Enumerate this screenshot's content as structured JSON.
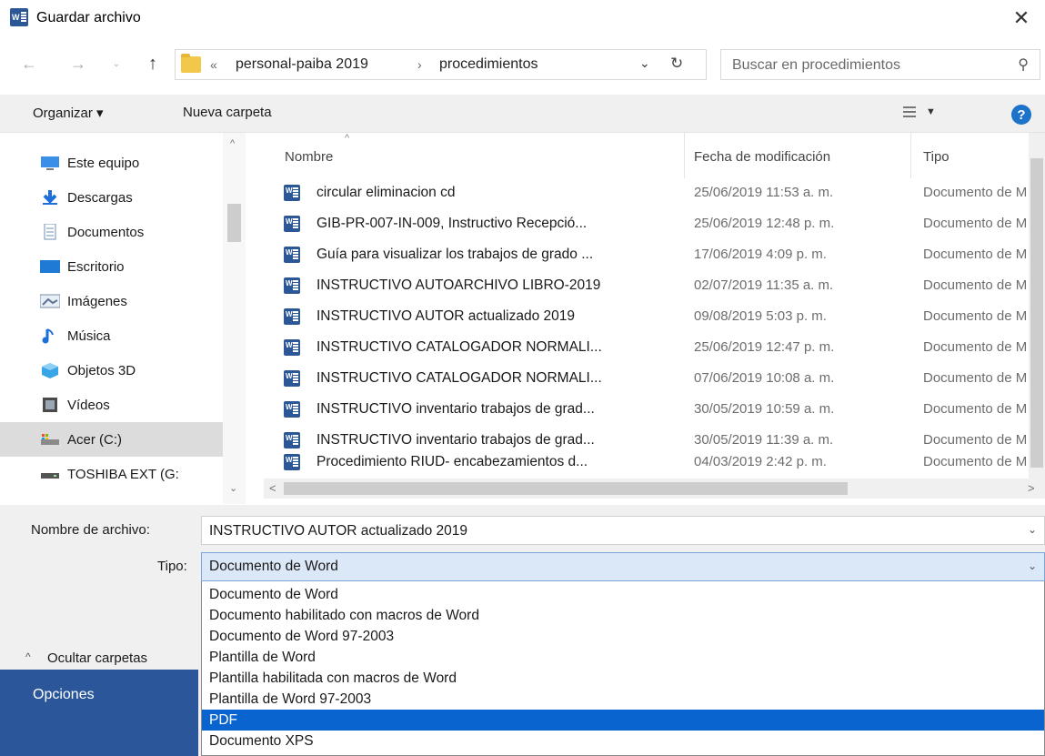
{
  "window": {
    "title": "Guardar archivo",
    "close_glyph": "✕"
  },
  "address": {
    "overflow_glyph": "«",
    "crumbs": [
      "personal-paiba 2019",
      "procedimientos"
    ],
    "separator": "›",
    "dropdown_glyph": "⌄",
    "refresh_glyph": "↻"
  },
  "nav_buttons": {
    "back": "←",
    "forward": "→",
    "history": "⌄",
    "up": "↑"
  },
  "search": {
    "placeholder": "Buscar en procedimientos",
    "icon_glyph": "⚲"
  },
  "toolbar": {
    "organize": "Organizar ▾",
    "new_folder": "Nueva carpeta",
    "view_dd": "▼",
    "help": "?"
  },
  "navpane": {
    "items": [
      {
        "label": "Este equipo",
        "icon": "computer-icon"
      },
      {
        "label": "Descargas",
        "icon": "downloads-icon"
      },
      {
        "label": "Documentos",
        "icon": "documents-icon"
      },
      {
        "label": "Escritorio",
        "icon": "desktop-icon"
      },
      {
        "label": "Imágenes",
        "icon": "pictures-icon"
      },
      {
        "label": "Música",
        "icon": "music-icon"
      },
      {
        "label": "Objetos 3D",
        "icon": "objects-3d-icon"
      },
      {
        "label": "Vídeos",
        "icon": "videos-icon"
      },
      {
        "label": "Acer (C:)",
        "icon": "drive-c-icon"
      },
      {
        "label": "TOSHIBA EXT (G:",
        "icon": "external-drive-icon"
      }
    ],
    "selected_index": 8,
    "scroll_up": "^",
    "scroll_down": "⌄"
  },
  "filelist": {
    "columns": [
      "Nombre",
      "Fecha de modificación",
      "Tipo"
    ],
    "sort_glyph": "^",
    "files": [
      {
        "name": "circular eliminacion cd",
        "date": "25/06/2019 11:53 a. m.",
        "type": "Documento de Microsoft Word"
      },
      {
        "name": "GIB-PR-007-IN-009, Instructivo Recepció...",
        "date": "25/06/2019 12:48 p. m.",
        "type": "Documento de Microsoft Word"
      },
      {
        "name": "Guía para visualizar los trabajos de grado ...",
        "date": "17/06/2019 4:09 p. m.",
        "type": "Documento de Microsoft Word"
      },
      {
        "name": "INSTRUCTIVO AUTOARCHIVO LIBRO-2019",
        "date": "02/07/2019 11:35 a. m.",
        "type": "Documento de Microsoft Word"
      },
      {
        "name": "INSTRUCTIVO AUTOR actualizado 2019",
        "date": "09/08/2019 5:03 p. m.",
        "type": "Documento de Microsoft Word"
      },
      {
        "name": "INSTRUCTIVO CATALOGADOR NORMALI...",
        "date": "25/06/2019 12:47 p. m.",
        "type": "Documento de Microsoft Word"
      },
      {
        "name": "INSTRUCTIVO CATALOGADOR NORMALI...",
        "date": "07/06/2019 10:08 a. m.",
        "type": "Documento de Microsoft Word"
      },
      {
        "name": "INSTRUCTIVO inventario trabajos de grad...",
        "date": "30/05/2019 10:59 a. m.",
        "type": "Documento de Microsoft Word"
      },
      {
        "name": "INSTRUCTIVO inventario trabajos de grad...",
        "date": "30/05/2019 11:39 a. m.",
        "type": "Documento de Microsoft Word"
      },
      {
        "name": "Procedimiento RIUD- encabezamientos d...",
        "date": "04/03/2019 2:42 p. m.",
        "type": "Documento de Microsoft Word"
      }
    ],
    "scroll_left": "<",
    "scroll_right": ">"
  },
  "form": {
    "filename_label": "Nombre de archivo:",
    "filename_value": "INSTRUCTIVO AUTOR actualizado 2019",
    "type_label": "Tipo:",
    "type_value": "Documento de Word",
    "dropdown_glyph": "⌄",
    "type_options": [
      "Documento de Word",
      "Documento habilitado con macros de Word",
      "Documento de Word 97-2003",
      "Plantilla de Word",
      "Plantilla habilitada con macros de Word",
      "Plantilla de Word 97-2003",
      "PDF",
      "Documento XPS"
    ],
    "type_selected_index": 6
  },
  "footer": {
    "hide_folders": "Ocultar carpetas",
    "hide_chevron": "^",
    "options_label": "Opciones"
  },
  "colors": {
    "accent_blue": "#0a64d0",
    "word_blue": "#2b579a",
    "folder_yellow": "#f3c74a",
    "selected_gray": "#dcdcdc"
  }
}
